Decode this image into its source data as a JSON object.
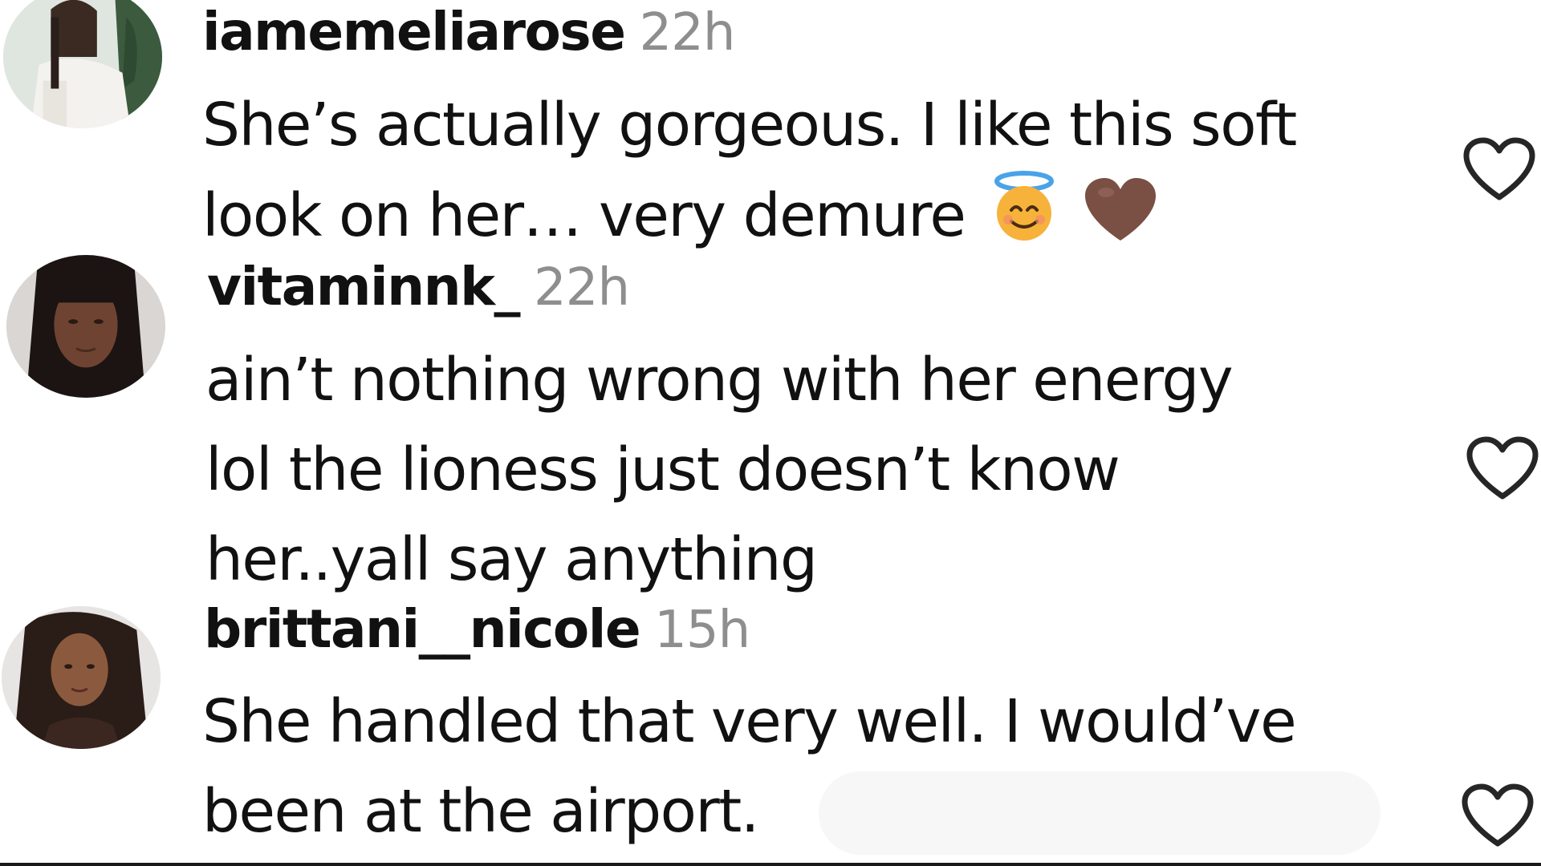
{
  "comments": [
    {
      "username": "iamemeliarose",
      "time": "22h",
      "lines": [
        "She’s actually gorgeous. I like this soft",
        "look on her… very demure"
      ],
      "emojis": [
        "smiling-face-with-halo",
        "brown-heart"
      ]
    },
    {
      "username": "vitaminnk_",
      "time": "22h",
      "lines": [
        "ain’t nothing wrong with her energy",
        "lol the lioness just doesn’t know",
        "her..yall say anything"
      ]
    },
    {
      "username": "brittani__nicole",
      "time": "15h",
      "lines": [
        "She handled that very well. I would’ve",
        "been at the airport."
      ]
    }
  ],
  "icons": {
    "like": "heart-outline-icon"
  },
  "colors": {
    "text": "#111111",
    "timestamp": "#8e8e8e",
    "heart_stroke": "#262626",
    "background": "#ffffff"
  }
}
